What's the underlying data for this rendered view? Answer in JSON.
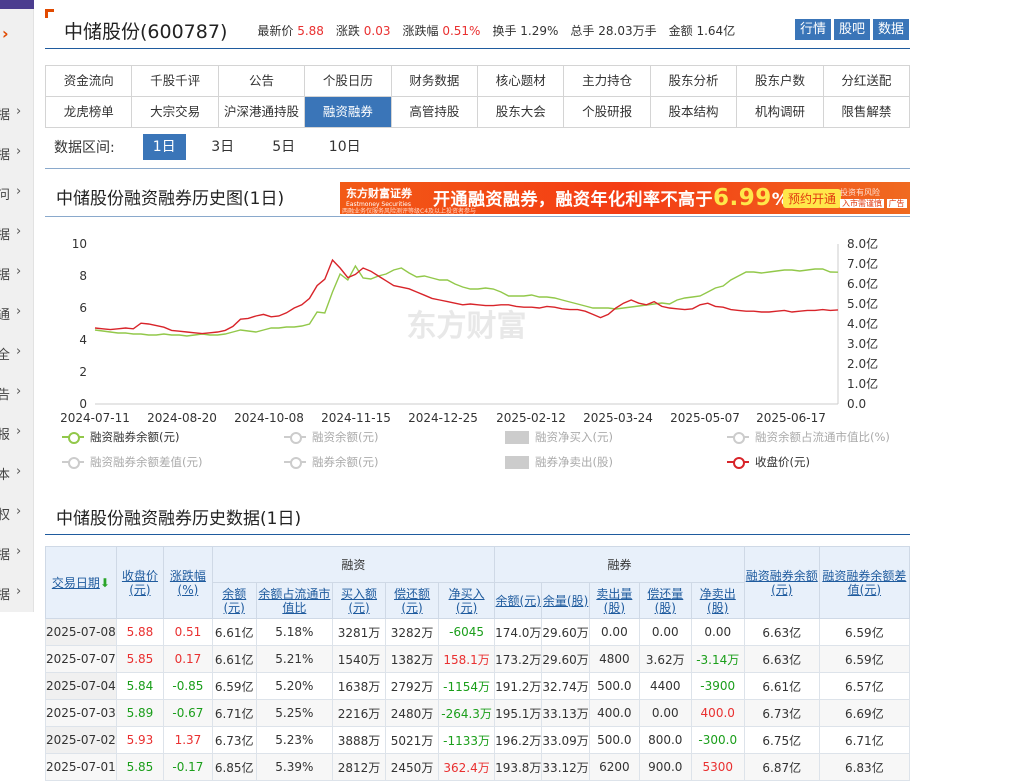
{
  "sidebar": {
    "top_arrow": "›",
    "items": [
      {
        "char": "据",
        "y": 108
      },
      {
        "char": "据",
        "y": 148
      },
      {
        "char": "问",
        "y": 188
      },
      {
        "char": "据",
        "y": 228
      },
      {
        "char": "据",
        "y": 268
      },
      {
        "char": "通",
        "y": 308
      },
      {
        "char": "全",
        "y": 348
      },
      {
        "char": "告",
        "y": 388
      },
      {
        "char": "报",
        "y": 428
      },
      {
        "char": "本",
        "y": 468
      },
      {
        "char": "权",
        "y": 508
      },
      {
        "char": "据",
        "y": 548
      },
      {
        "char": "据",
        "y": 588
      }
    ]
  },
  "header": {
    "stock_name": "中储股份(600787)",
    "latest_label": "最新价",
    "latest_value": "5.88",
    "change_label": "涨跌",
    "change_value": "0.03",
    "pct_label": "涨跌幅",
    "pct_value": "0.51%",
    "turnover_label": "换手",
    "turnover_value": "1.29%",
    "volume_label": "总手",
    "volume_value": "28.03万手",
    "amount_label": "金额",
    "amount_value": "1.64亿",
    "buttons": [
      "行情",
      "股吧",
      "数据"
    ]
  },
  "nav": {
    "row1": [
      "资金流向",
      "千股千评",
      "公告",
      "个股日历",
      "财务数据",
      "核心题材",
      "主力持仓",
      "股东分析",
      "股东户数",
      "分红送配"
    ],
    "row2": [
      "龙虎榜单",
      "大宗交易",
      "沪深港通持股",
      "融资融券",
      "高管持股",
      "股东大会",
      "个股研报",
      "股本结构",
      "机构调研",
      "限售解禁"
    ],
    "active": "融资融券"
  },
  "range": {
    "label": "数据区间:",
    "options": [
      "1日",
      "3日",
      "5日",
      "10日"
    ],
    "active": "1日"
  },
  "chart_section_title": "中储股份融资融券历史图(1日)",
  "ad": {
    "brand": "东方财富证券",
    "brand_en": "Eastmoney Securities",
    "fine": "两融业务仅服务风险测评等级C4及以上投资者参与",
    "text_before": "开通融资融券，融资年化利率不高于",
    "rate": "6.99",
    "text_after": "%！",
    "button": "预约开通",
    "risk_line1": "投资有风险",
    "risk_line2": "入市需谨慎",
    "risk_tag": "广告"
  },
  "chart_data": {
    "type": "line",
    "x_labels": [
      "2024-07-11",
      "2024-08-20",
      "2024-10-08",
      "2024-11-15",
      "2024-12-25",
      "2025-02-12",
      "2025-03-24",
      "2025-05-07",
      "2025-06-17"
    ],
    "y_left_ticks": [
      "10",
      "8",
      "6",
      "4",
      "2",
      "0"
    ],
    "y_right_ticks": [
      "8.0亿",
      "7.0亿",
      "6.0亿",
      "5.0亿",
      "4.0亿",
      "3.0亿",
      "2.0亿",
      "1.0亿",
      "0.0"
    ],
    "ylim_left": [
      0,
      10
    ],
    "ylim_right": [
      0,
      8
    ],
    "watermark": "东方财富",
    "series": [
      {
        "name": "融资融券余额(元)",
        "axis": "right",
        "color": "#92c84a",
        "values": [
          3.7,
          3.65,
          3.6,
          3.55,
          3.55,
          3.5,
          3.5,
          3.45,
          3.45,
          3.5,
          3.45,
          3.45,
          3.4,
          3.45,
          3.5,
          3.45,
          3.45,
          3.5,
          3.6,
          3.7,
          3.65,
          3.6,
          3.7,
          3.8,
          3.8,
          3.85,
          3.85,
          3.9,
          4.0,
          4.6,
          4.55,
          5.6,
          6.5,
          6.2,
          6.9,
          6.3,
          6.25,
          6.4,
          6.5,
          6.7,
          6.8,
          6.55,
          6.35,
          6.4,
          6.3,
          6.2,
          6.2,
          6.0,
          5.85,
          5.75,
          5.75,
          5.8,
          5.75,
          5.6,
          5.4,
          5.4,
          5.4,
          5.45,
          5.35,
          5.35,
          5.3,
          5.2,
          5.1,
          5.0,
          4.9,
          4.8,
          4.8,
          4.8,
          4.75,
          4.8,
          4.85,
          4.9,
          4.95,
          5.0,
          5.05,
          5.0,
          5.2,
          5.3,
          5.35,
          5.4,
          5.6,
          5.8,
          5.9,
          6.2,
          6.4,
          6.6,
          6.6,
          6.55,
          6.6,
          6.65,
          6.7,
          6.7,
          6.65,
          6.7,
          6.75,
          6.75,
          6.6,
          6.59
        ]
      },
      {
        "name": "收盘价(元)",
        "axis": "left",
        "color": "#d8242a",
        "values": [
          4.75,
          4.7,
          4.65,
          4.7,
          4.75,
          4.7,
          5.05,
          5.0,
          4.9,
          4.8,
          4.6,
          4.55,
          4.5,
          4.45,
          4.4,
          4.45,
          4.5,
          4.6,
          4.85,
          5.3,
          5.35,
          5.5,
          5.6,
          5.45,
          5.5,
          5.7,
          6.0,
          6.2,
          6.6,
          7.4,
          7.8,
          9.0,
          8.5,
          7.9,
          8.1,
          8.5,
          8.3,
          8.0,
          7.7,
          7.4,
          7.3,
          7.2,
          7.0,
          6.8,
          6.6,
          6.5,
          6.4,
          6.3,
          6.2,
          6.25,
          6.2,
          6.15,
          6.15,
          6.2,
          6.2,
          6.1,
          6.05,
          6.05,
          6.0,
          6.1,
          6.05,
          5.95,
          5.9,
          5.9,
          5.8,
          5.6,
          5.4,
          5.6,
          6.0,
          6.3,
          6.5,
          6.3,
          6.2,
          6.4,
          6.1,
          6.0,
          5.95,
          5.9,
          5.95,
          6.2,
          6.3,
          6.1,
          6.05,
          5.9,
          5.85,
          5.8,
          5.8,
          5.75,
          5.75,
          5.8,
          5.85,
          5.75,
          5.8,
          5.85,
          5.85,
          5.9,
          5.85,
          5.88
        ]
      }
    ]
  },
  "legend": [
    {
      "label": "融资融券余额(元)",
      "kind": "line",
      "on": true,
      "color": "g"
    },
    {
      "label": "融资余额(元)",
      "kind": "line",
      "on": false
    },
    {
      "label": "融资净买入(元)",
      "kind": "box",
      "on": false
    },
    {
      "label": "融资余额占流通市值比(%)",
      "kind": "line",
      "on": false
    },
    {
      "label": "融资融券余额差值(元)",
      "kind": "line",
      "on": false
    },
    {
      "label": "融券余额(元)",
      "kind": "line",
      "on": false
    },
    {
      "label": "融券净卖出(股)",
      "kind": "box",
      "on": false
    },
    {
      "label": "收盘价(元)",
      "kind": "line",
      "on": true,
      "color": "r"
    }
  ],
  "table_section_title": "中储股份融资融券历史数据(1日)",
  "table": {
    "group_financing": "融资",
    "group_lending": "融券",
    "headers": {
      "date": "交易日期",
      "close": "收盘价(元)",
      "pct": "涨跌幅(%)",
      "fin_balance": "余额(元)",
      "fin_ratio": "余额占流通市值比",
      "fin_buy": "买入额(元)",
      "fin_repay": "偿还额(元)",
      "fin_net": "净买入(元)",
      "sl_amount": "余额(元)",
      "sl_volume": "余量(股)",
      "sl_sell": "卖出量(股)",
      "sl_repay": "偿还量(股)",
      "sl_net": "净卖出(股)",
      "total": "融资融券余额(元)",
      "diff": "融资融券余额差值(元)"
    },
    "rows": [
      {
        "date": "2025-07-08",
        "close": "5.88",
        "pct": "0.51",
        "fin_balance": "6.61亿",
        "fin_ratio": "5.18%",
        "fin_buy": "3281万",
        "fin_repay": "3282万",
        "fin_net": "-6045",
        "sl_amount": "174.0万",
        "sl_volume": "29.60万",
        "sl_sell": "0.00",
        "sl_repay": "0.00",
        "sl_net": "0.00",
        "total": "6.63亿",
        "diff": "6.59亿",
        "close_c": "red",
        "pct_c": "red",
        "fin_net_c": "green",
        "sl_net_c": ""
      },
      {
        "date": "2025-07-07",
        "close": "5.85",
        "pct": "0.17",
        "fin_balance": "6.61亿",
        "fin_ratio": "5.21%",
        "fin_buy": "1540万",
        "fin_repay": "1382万",
        "fin_net": "158.1万",
        "sl_amount": "173.2万",
        "sl_volume": "29.60万",
        "sl_sell": "4800",
        "sl_repay": "3.62万",
        "sl_net": "-3.14万",
        "total": "6.63亿",
        "diff": "6.59亿",
        "close_c": "red",
        "pct_c": "red",
        "fin_net_c": "red",
        "sl_net_c": "green"
      },
      {
        "date": "2025-07-04",
        "close": "5.84",
        "pct": "-0.85",
        "fin_balance": "6.59亿",
        "fin_ratio": "5.20%",
        "fin_buy": "1638万",
        "fin_repay": "2792万",
        "fin_net": "-1154万",
        "sl_amount": "191.2万",
        "sl_volume": "32.74万",
        "sl_sell": "500.0",
        "sl_repay": "4400",
        "sl_net": "-3900",
        "total": "6.61亿",
        "diff": "6.57亿",
        "close_c": "green",
        "pct_c": "green",
        "fin_net_c": "green",
        "sl_net_c": "green"
      },
      {
        "date": "2025-07-03",
        "close": "5.89",
        "pct": "-0.67",
        "fin_balance": "6.71亿",
        "fin_ratio": "5.25%",
        "fin_buy": "2216万",
        "fin_repay": "2480万",
        "fin_net": "-264.3万",
        "sl_amount": "195.1万",
        "sl_volume": "33.13万",
        "sl_sell": "400.0",
        "sl_repay": "0.00",
        "sl_net": "400.0",
        "total": "6.73亿",
        "diff": "6.69亿",
        "close_c": "green",
        "pct_c": "green",
        "fin_net_c": "green",
        "sl_net_c": "red"
      },
      {
        "date": "2025-07-02",
        "close": "5.93",
        "pct": "1.37",
        "fin_balance": "6.73亿",
        "fin_ratio": "5.23%",
        "fin_buy": "3888万",
        "fin_repay": "5021万",
        "fin_net": "-1133万",
        "sl_amount": "196.2万",
        "sl_volume": "33.09万",
        "sl_sell": "500.0",
        "sl_repay": "800.0",
        "sl_net": "-300.0",
        "total": "6.75亿",
        "diff": "6.71亿",
        "close_c": "red",
        "pct_c": "red",
        "fin_net_c": "green",
        "sl_net_c": "green"
      },
      {
        "date": "2025-07-01",
        "close": "5.85",
        "pct": "-0.17",
        "fin_balance": "6.85亿",
        "fin_ratio": "5.39%",
        "fin_buy": "2812万",
        "fin_repay": "2450万",
        "fin_net": "362.4万",
        "sl_amount": "193.8万",
        "sl_volume": "33.12万",
        "sl_sell": "6200",
        "sl_repay": "900.0",
        "sl_net": "5300",
        "total": "6.87亿",
        "diff": "6.83亿",
        "close_c": "green",
        "pct_c": "green",
        "fin_net_c": "red",
        "sl_net_c": "red"
      }
    ]
  }
}
